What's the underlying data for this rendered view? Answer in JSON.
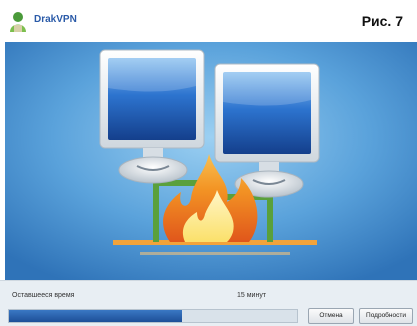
{
  "header": {
    "app_name": "DrakVPN",
    "figure_label": "Рис. 7",
    "logo_icon": "drakvpn-logo-icon"
  },
  "illustration": {
    "icons": [
      "monitor-left-icon",
      "monitor-right-icon",
      "firewall-flame-icon",
      "network-line-icon"
    ],
    "colors": {
      "background": "#3f86c8",
      "network_line": "#f2a33a",
      "connector": "#5aa03c",
      "screen": "#2a6fc9",
      "flame": "#f7a21b"
    }
  },
  "status": {
    "remaining_label": "Оставшееся время",
    "time_value": "15 минут",
    "progress_fraction": 0.6
  },
  "buttons": {
    "cancel_label": "Отмена",
    "details_label": "Подробности"
  }
}
